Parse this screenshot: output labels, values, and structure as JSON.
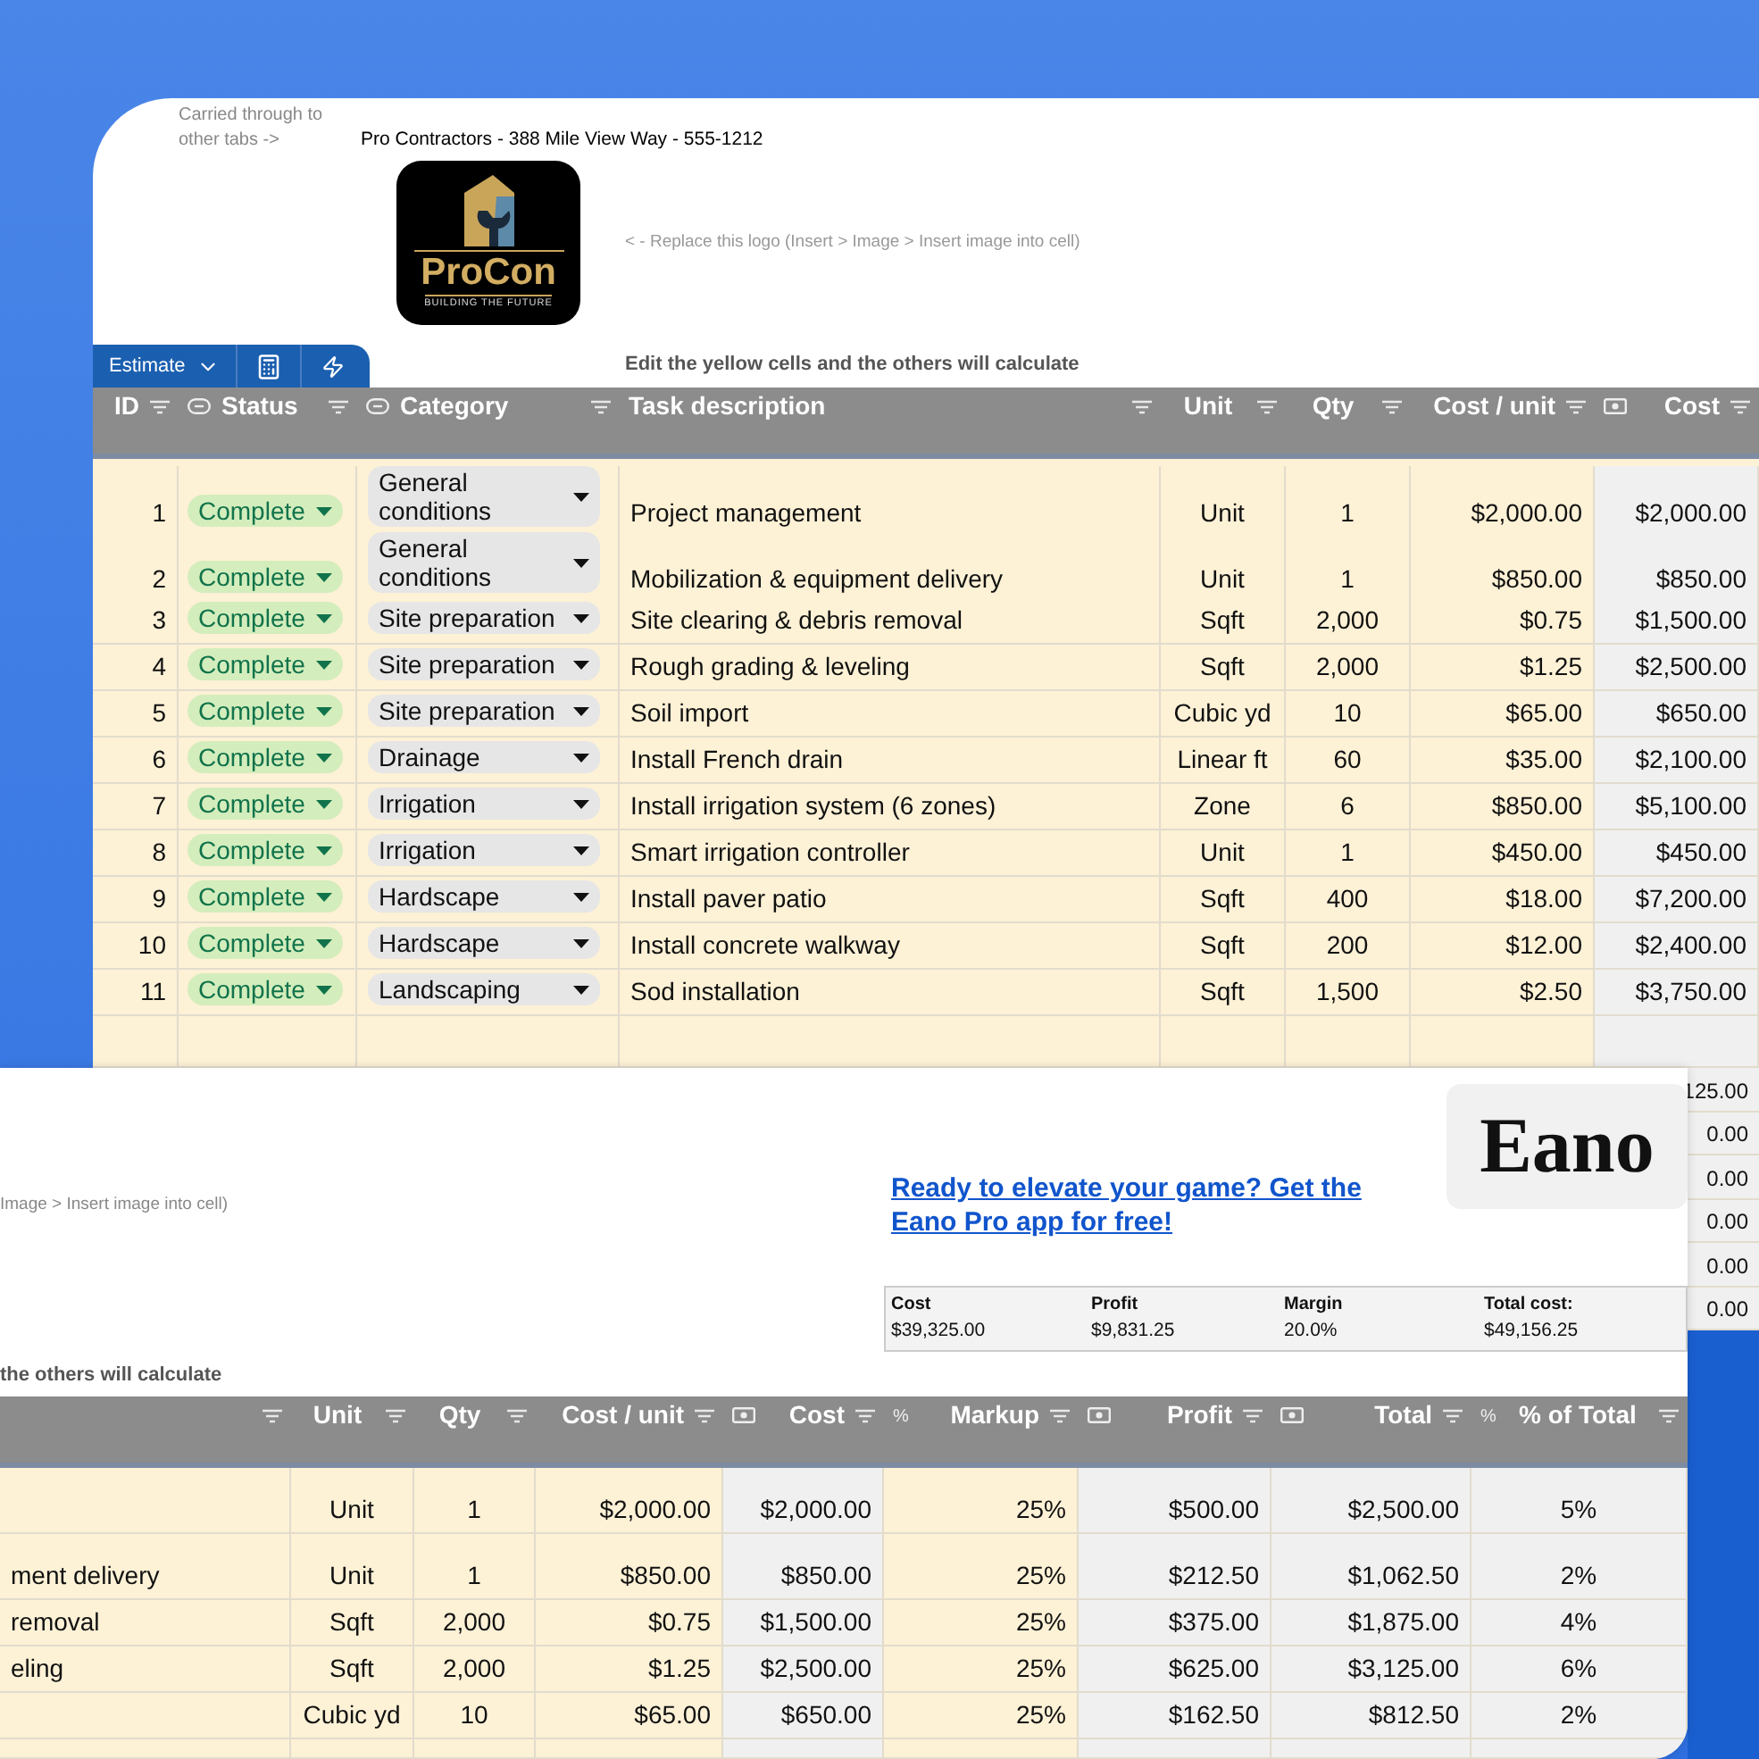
{
  "sheet_top": {
    "note": "Carried through to other tabs ->",
    "company": "Pro Contractors - 388 Mile View Way - 555-1212",
    "logo": {
      "name": "ProCon",
      "tagline": "BUILDING THE FUTURE"
    },
    "logo_hint": "< - Replace this logo (Insert > Image > Insert image into cell)",
    "toolbar": {
      "tab": "Estimate"
    },
    "instruction": "Edit the yellow cells and the others will calculate",
    "columns": [
      {
        "label": "ID",
        "kind": "plain",
        "editable": true
      },
      {
        "label": "Status",
        "kind": "dropdown",
        "editable": true
      },
      {
        "label": "Category",
        "kind": "dropdown",
        "editable": true
      },
      {
        "label": "Task description",
        "kind": "plain",
        "editable": true
      },
      {
        "label": "Unit",
        "kind": "plain",
        "editable": true
      },
      {
        "label": "Qty",
        "kind": "plain",
        "editable": true
      },
      {
        "label": "Cost / unit",
        "kind": "plain",
        "editable": true
      },
      {
        "label": "Cost",
        "kind": "money",
        "editable": false
      }
    ],
    "rows": [
      {
        "cells": [
          "1",
          "Complete",
          "General conditions",
          "Project management",
          "Unit",
          "1",
          "$2,000.00",
          "$2,000.00"
        ]
      },
      {
        "cells": [
          "2",
          "Complete",
          "General conditions",
          "Mobilization & equipment delivery",
          "Unit",
          "1",
          "$850.00",
          "$850.00"
        ]
      },
      {
        "cells": [
          "3",
          "Complete",
          "Site preparation",
          "Site clearing & debris removal",
          "Sqft",
          "2,000",
          "$0.75",
          "$1,500.00"
        ]
      },
      {
        "cells": [
          "4",
          "Complete",
          "Site preparation",
          "Rough grading & leveling",
          "Sqft",
          "2,000",
          "$1.25",
          "$2,500.00"
        ]
      },
      {
        "cells": [
          "5",
          "Complete",
          "Site preparation",
          "Soil import",
          "Cubic yd",
          "10",
          "$65.00",
          "$650.00"
        ]
      },
      {
        "cells": [
          "6",
          "Complete",
          "Drainage",
          "Install French drain",
          "Linear ft",
          "60",
          "$35.00",
          "$2,100.00"
        ]
      },
      {
        "cells": [
          "7",
          "Complete",
          "Irrigation",
          "Install irrigation system (6 zones)",
          "Zone",
          "6",
          "$850.00",
          "$5,100.00"
        ]
      },
      {
        "cells": [
          "8",
          "Complete",
          "Irrigation",
          "Smart irrigation controller",
          "Unit",
          "1",
          "$450.00",
          "$450.00"
        ]
      },
      {
        "cells": [
          "9",
          "Complete",
          "Hardscape",
          "Install paver patio",
          "Sqft",
          "400",
          "$18.00",
          "$7,200.00"
        ]
      },
      {
        "cells": [
          "10",
          "Complete",
          "Hardscape",
          "Install concrete walkway",
          "Sqft",
          "200",
          "$12.00",
          "$2,400.00"
        ]
      },
      {
        "cells": [
          "11",
          "Complete",
          "Landscaping",
          "Sod installation",
          "Sqft",
          "1,500",
          "$2.50",
          "$3,750.00"
        ]
      }
    ],
    "edge_cells": [
      "125.00",
      "0.00",
      "0.00",
      "0.00",
      "0.00",
      "0.00"
    ]
  },
  "sheet_bottom": {
    "logo_hint": "Image > Insert image into cell)",
    "promo_link": "Ready to elevate your game? Get the Eano Pro app for free!",
    "brand": "Eano",
    "summary": {
      "headers": [
        "Cost",
        "Profit",
        "Margin",
        "Total cost:"
      ],
      "values": [
        "$39,325.00",
        "$9,831.25",
        "20.0%",
        "$49,156.25"
      ]
    },
    "instruction": "the others will calculate",
    "columns": [
      {
        "kind": "plain",
        "editable": true
      },
      {
        "label": "Unit",
        "kind": "plain",
        "editable": true
      },
      {
        "label": "Qty",
        "kind": "plain",
        "editable": true
      },
      {
        "label": "Cost / unit",
        "kind": "plain",
        "editable": true
      },
      {
        "label": "Cost",
        "kind": "money",
        "editable": false
      },
      {
        "label": "Markup",
        "kind": "percent",
        "glyph": "%",
        "editable": true
      },
      {
        "label": "Profit",
        "kind": "money",
        "editable": false
      },
      {
        "label": "Total",
        "kind": "money",
        "editable": false
      },
      {
        "label": "% of Total",
        "kind": "percent",
        "glyph": "%",
        "editable": false
      }
    ],
    "rows": [
      {
        "cells": [
          "",
          "Unit",
          "1",
          "$2,000.00",
          "$2,000.00",
          "25%",
          "$500.00",
          "$2,500.00",
          "5%"
        ]
      },
      {
        "cells": [
          "ment delivery",
          "Unit",
          "1",
          "$850.00",
          "$850.00",
          "25%",
          "$212.50",
          "$1,062.50",
          "2%"
        ]
      },
      {
        "cells": [
          "removal",
          "Sqft",
          "2,000",
          "$0.75",
          "$1,500.00",
          "25%",
          "$375.00",
          "$1,875.00",
          "4%"
        ]
      },
      {
        "cells": [
          "eling",
          "Sqft",
          "2,000",
          "$1.25",
          "$2,500.00",
          "25%",
          "$625.00",
          "$3,125.00",
          "6%"
        ]
      },
      {
        "cells": [
          "",
          "Cubic yd",
          "10",
          "$65.00",
          "$650.00",
          "25%",
          "$162.50",
          "$812.50",
          "2%"
        ]
      }
    ]
  }
}
